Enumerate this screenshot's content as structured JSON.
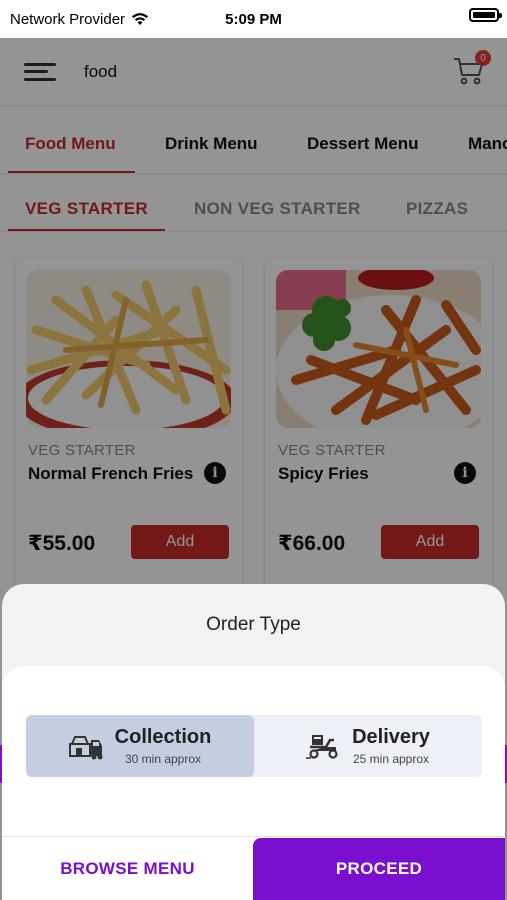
{
  "status_bar": {
    "carrier": "Network Provider",
    "time": "5:09 PM"
  },
  "header": {
    "title": "food",
    "cart_count": "0"
  },
  "menu_tabs": [
    {
      "label": "Food Menu",
      "active": true
    },
    {
      "label": "Drink Menu",
      "active": false
    },
    {
      "label": "Dessert Menu",
      "active": false
    },
    {
      "label": "Manc",
      "active": false
    }
  ],
  "category_tabs": [
    {
      "label": "VEG STARTER",
      "active": true
    },
    {
      "label": "NON VEG STARTER",
      "active": false
    },
    {
      "label": "PIZZAS",
      "active": false
    }
  ],
  "products": [
    {
      "category": "VEG STARTER",
      "name": "Normal French Fries",
      "price": "₹55.00",
      "add_label": "Add"
    },
    {
      "category": "VEG STARTER",
      "name": "Spicy Fries",
      "price": "₹66.00",
      "add_label": "Add"
    }
  ],
  "order_sheet": {
    "title": "Order Type",
    "options": [
      {
        "label": "Collection",
        "sub": "30 min approx",
        "selected": true
      },
      {
        "label": "Delivery",
        "sub": "25 min approx",
        "selected": false
      }
    ],
    "browse_label": "BROWSE MENU",
    "proceed_label": "PROCEED"
  },
  "colors": {
    "accent_red": "#c62828",
    "accent_purple": "#7a0fd0",
    "selected_segment": "#c5cde0"
  },
  "icons": {
    "menu": "hamburger-icon",
    "cart": "cart-icon",
    "info": "info-icon",
    "collection": "store-icon",
    "delivery": "scooter-icon"
  }
}
